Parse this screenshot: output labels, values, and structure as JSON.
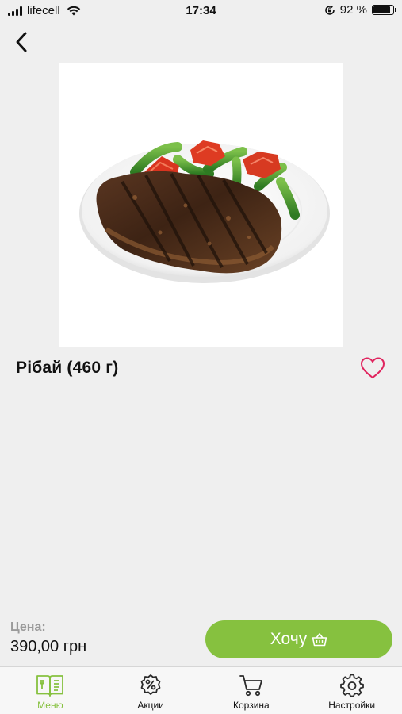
{
  "status_bar": {
    "carrier": "lifecell",
    "time": "17:34",
    "battery": "92 %",
    "battery_level": 0.92
  },
  "product": {
    "title": "Рібай (460 г)",
    "image_icon": "ribeye-steak-plate-image"
  },
  "price": {
    "label": "Цена:",
    "value": "390,00 грн"
  },
  "actions": {
    "want_label": "Хочу",
    "accent": "#86c13f",
    "favorite_color": "#e0245e"
  },
  "tabs": [
    {
      "label": "Меню",
      "icon": "menu-book-icon",
      "active": true
    },
    {
      "label": "Акции",
      "icon": "discount-icon",
      "active": false
    },
    {
      "label": "Корзина",
      "icon": "cart-icon",
      "active": false
    },
    {
      "label": "Настройки",
      "icon": "gear-icon",
      "active": false
    }
  ]
}
